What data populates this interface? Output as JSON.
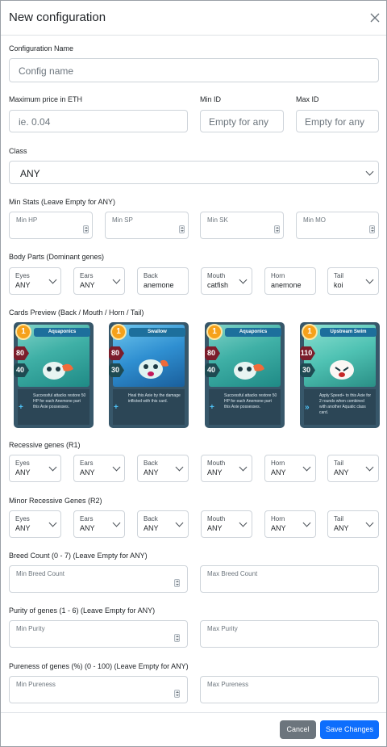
{
  "header": {
    "title": "New configuration"
  },
  "config_name": {
    "label": "Configuration Name",
    "placeholder": "Config name"
  },
  "price": {
    "label": "Maximum price in ETH",
    "placeholder": "ie. 0.04"
  },
  "min_id": {
    "label": "Min ID",
    "placeholder": "Empty for any"
  },
  "max_id": {
    "label": "Max ID",
    "placeholder": "Empty for any"
  },
  "class": {
    "label": "Class",
    "value": "ANY"
  },
  "stats": {
    "label": "Min Stats (Leave Empty for ANY)",
    "fields": [
      "Min HP",
      "Min SP",
      "Min SK",
      "Min MO"
    ]
  },
  "body_parts": {
    "label": "Body Parts (Dominant genes)",
    "parts": [
      {
        "name": "Eyes",
        "value": "ANY"
      },
      {
        "name": "Ears",
        "value": "ANY"
      },
      {
        "name": "Back",
        "value": "anemone"
      },
      {
        "name": "Mouth",
        "value": "catfish"
      },
      {
        "name": "Horn",
        "value": "anemone"
      },
      {
        "name": "Tail",
        "value": "koi"
      }
    ]
  },
  "cards": {
    "label": "Cards Preview (Back / Mouth / Horn / Tail)",
    "items": [
      {
        "name": "Aquaponics",
        "energy": "1",
        "attack": "80",
        "defense": "40",
        "desc": "Successful attacks restore 50 HP for each Anemone part this Axie possesses."
      },
      {
        "name": "Swallow",
        "energy": "1",
        "attack": "80",
        "defense": "30",
        "desc": "Heal this Axie by the damage inflicted with this card."
      },
      {
        "name": "Aquaponics",
        "energy": "1",
        "attack": "80",
        "defense": "40",
        "desc": "Successful attacks restore 50 HP for each Anemone part this Axie possesses."
      },
      {
        "name": "Upstream Swim",
        "energy": "1",
        "attack": "110",
        "defense": "30",
        "desc": "Apply Speed+ to this Axie for 2 rounds when combined with another Aquatic class card."
      }
    ]
  },
  "recessive_r1": {
    "label": "Recessive genes (R1)",
    "parts": [
      {
        "name": "Eyes",
        "value": "ANY"
      },
      {
        "name": "Ears",
        "value": "ANY"
      },
      {
        "name": "Back",
        "value": "ANY"
      },
      {
        "name": "Mouth",
        "value": "ANY"
      },
      {
        "name": "Horn",
        "value": "ANY"
      },
      {
        "name": "Tail",
        "value": "ANY"
      }
    ]
  },
  "recessive_r2": {
    "label": "Minor Recessive Genes (R2)",
    "parts": [
      {
        "name": "Eyes",
        "value": "ANY"
      },
      {
        "name": "Ears",
        "value": "ANY"
      },
      {
        "name": "Back",
        "value": "ANY"
      },
      {
        "name": "Mouth",
        "value": "ANY"
      },
      {
        "name": "Horn",
        "value": "ANY"
      },
      {
        "name": "Tail",
        "value": "ANY"
      }
    ]
  },
  "breed": {
    "label": "Breed Count (0 - 7) (Leave Empty for ANY)",
    "min": "Min Breed Count",
    "max": "Max Breed Count"
  },
  "purity": {
    "label": "Purity of genes (1 - 6) (Leave Empty for ANY)",
    "min": "Min Purity",
    "max": "Max Purity"
  },
  "pureness": {
    "label": "Pureness of genes (%) (0 - 100) (Leave Empty for ANY)",
    "min": "Min Pureness",
    "max": "Max Pureness"
  },
  "footer": {
    "cancel": "Cancel",
    "save": "Save Changes"
  },
  "colors": {
    "primary": "#0d6efd",
    "secondary": "#6c757d"
  }
}
